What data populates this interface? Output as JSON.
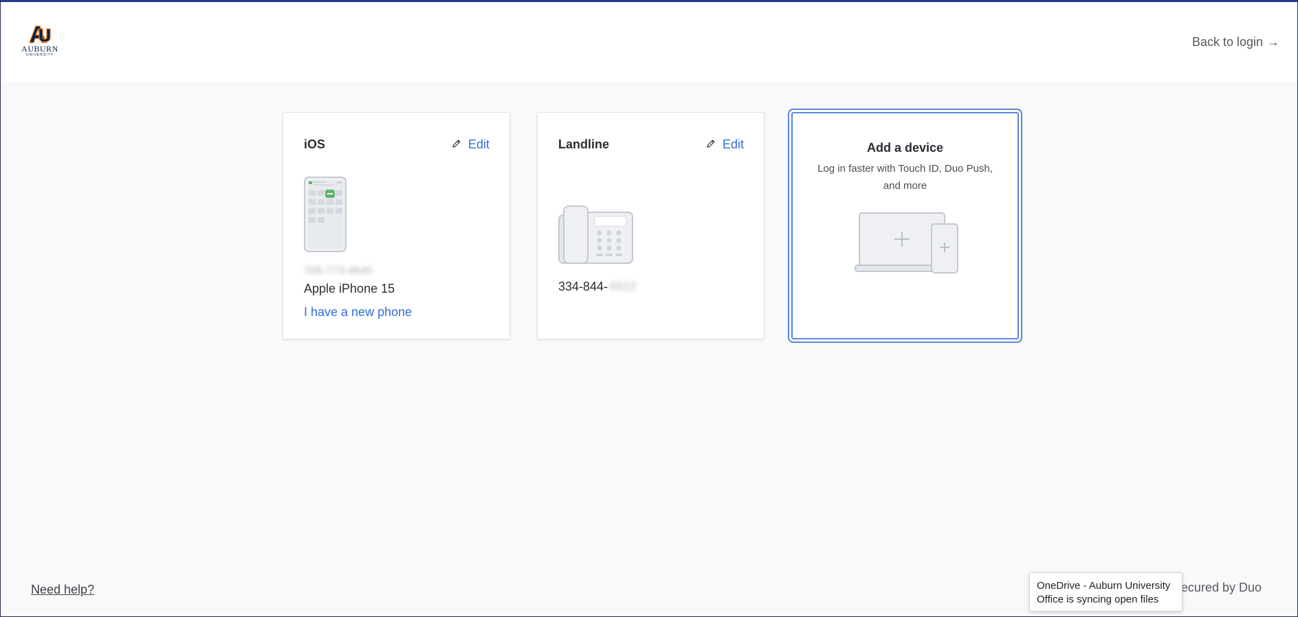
{
  "header": {
    "logo_word": "AUBURN",
    "logo_sub": "UNIVERSITY",
    "back_login": "Back to login",
    "back_arrow": "→"
  },
  "cards": [
    {
      "title": "iOS",
      "edit_label": "Edit",
      "masked_number": "706-773-4645",
      "model": "Apple iPhone 15",
      "new_phone_link": "I have a new phone"
    },
    {
      "title": "Landline",
      "edit_label": "Edit",
      "number_visible": "334-844-",
      "number_masked": "4933"
    }
  ],
  "add_device": {
    "title": "Add a device",
    "description": "Log in faster with Touch ID, Duo Push, and more"
  },
  "footer": {
    "need_help": "Need help?",
    "secured": "ecured by Duo"
  },
  "toast": {
    "line1": "OneDrive - Auburn University",
    "line2": "Office is syncing open files"
  },
  "colors": {
    "accent": "#2f6fd6",
    "brand_navy": "#0c2340",
    "brand_orange": "#e87722",
    "selected_border": "#5b86d8"
  }
}
